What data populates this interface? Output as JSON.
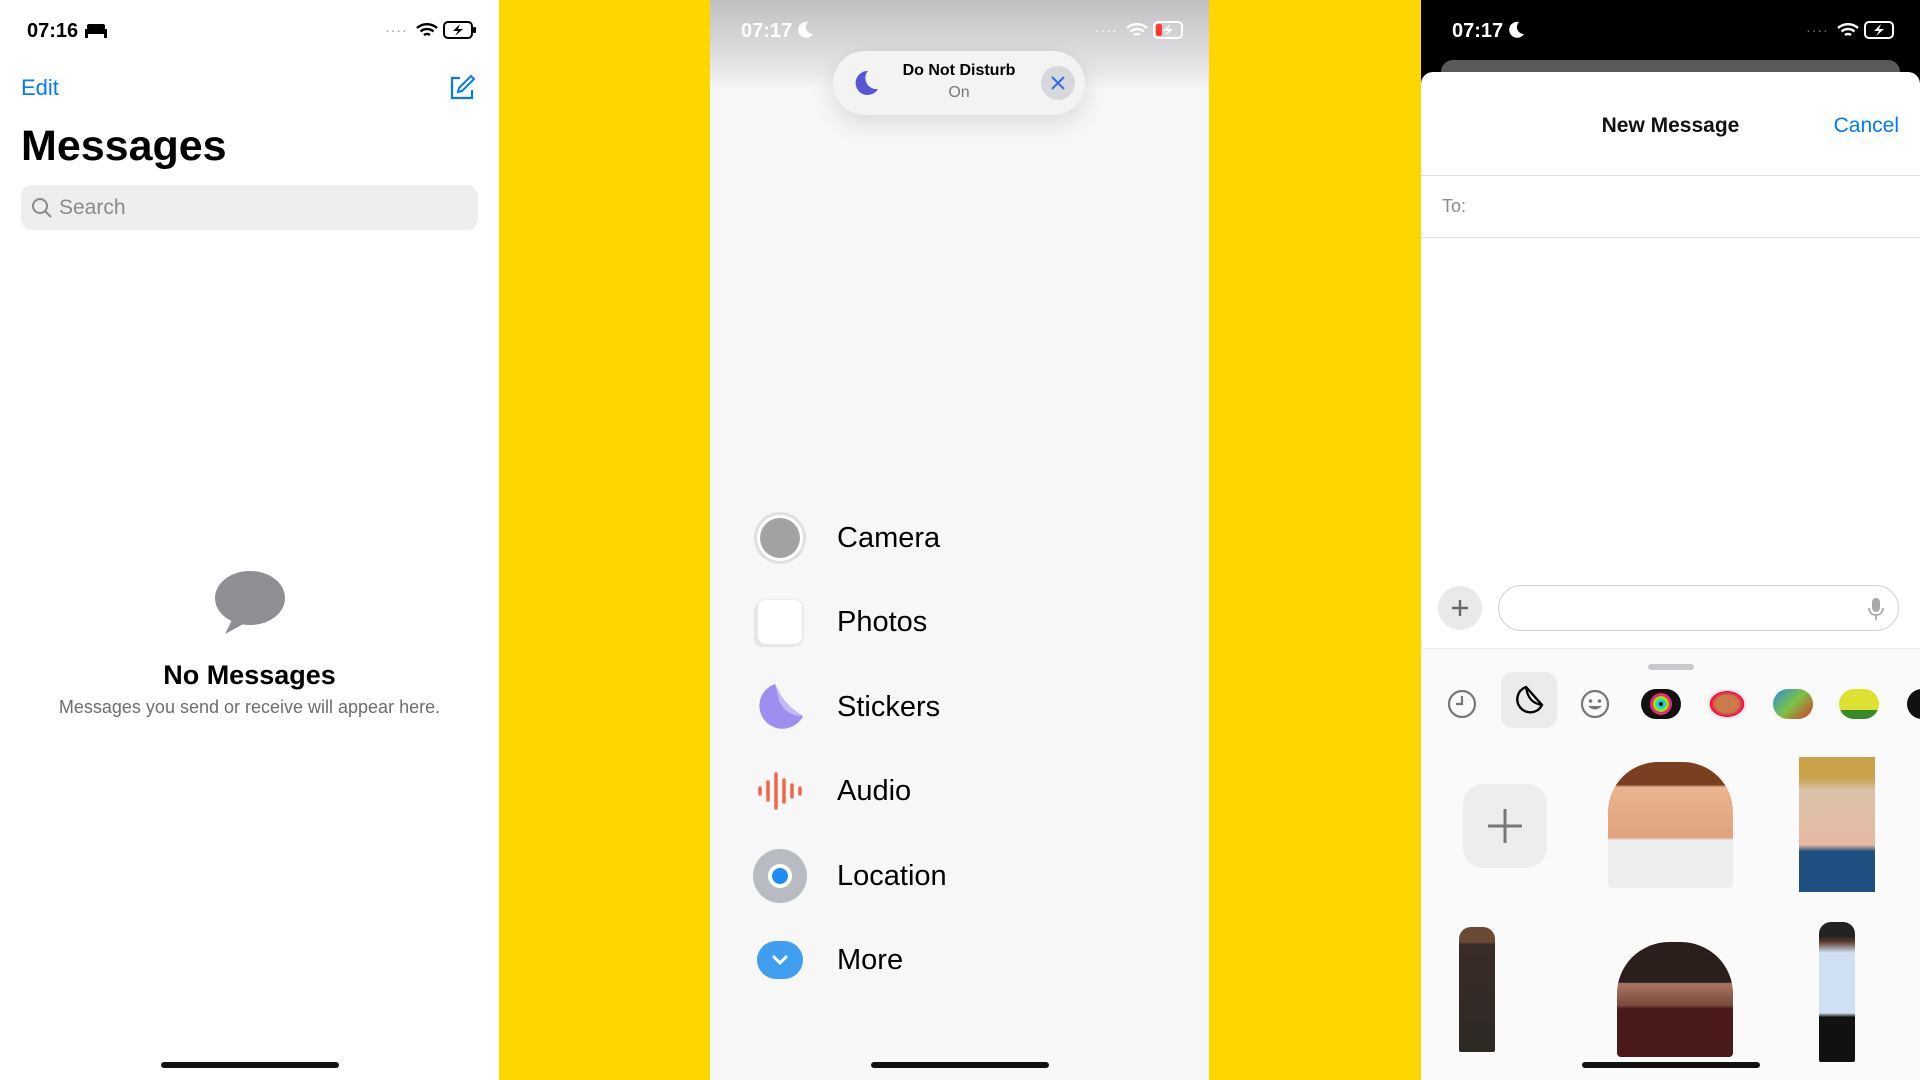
{
  "panel1": {
    "status_time": "07:16",
    "edit_label": "Edit",
    "title": "Messages",
    "search_placeholder": "Search",
    "empty_title": "No Messages",
    "empty_subtitle": "Messages you send or receive will appear here."
  },
  "panel2": {
    "status_time": "07:17",
    "dnd": {
      "title": "Do Not Disturb",
      "status": "On"
    },
    "menu": [
      {
        "label": "Camera",
        "icon": "camera-icon"
      },
      {
        "label": "Photos",
        "icon": "photos-icon"
      },
      {
        "label": "Stickers",
        "icon": "stickers-icon"
      },
      {
        "label": "Audio",
        "icon": "audio-icon"
      },
      {
        "label": "Location",
        "icon": "location-icon"
      },
      {
        "label": "More",
        "icon": "chevron-down-icon"
      }
    ]
  },
  "panel3": {
    "status_time": "07:17",
    "title": "New Message",
    "cancel_label": "Cancel",
    "to_label": "To:",
    "tray_tabs": [
      "recents-icon",
      "stickers-icon",
      "emoji-icon",
      "activity-icon",
      "memoji-icon",
      "fruit-ninja-icon",
      "doodle-jump-icon"
    ]
  },
  "colors": {
    "accent": "#007AFF",
    "background": "#FFD600",
    "dnd_moon": "#5856D6",
    "audio": "#F2674A"
  }
}
